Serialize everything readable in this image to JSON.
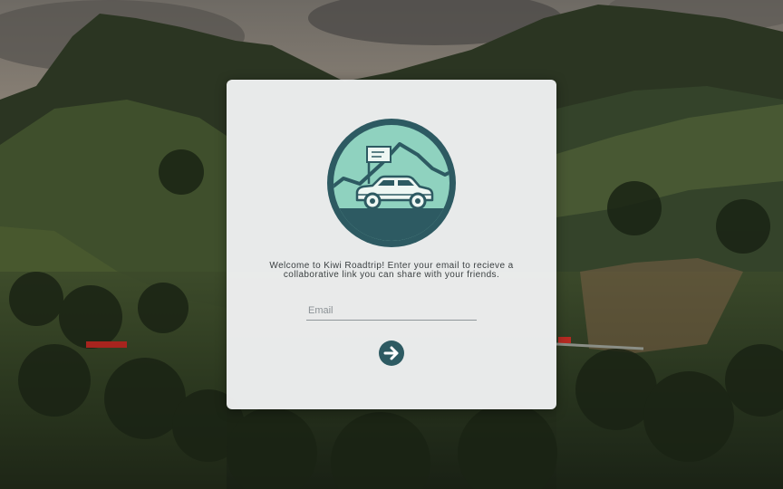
{
  "app": {
    "name": "Kiwi Roadtrip"
  },
  "signup": {
    "welcome_text": "Welcome to Kiwi Roadtrip! Enter your email to recieve a collaborative link you can share with your friends.",
    "email_placeholder": "Email",
    "email_value": "",
    "submit_icon": "arrow-right-icon"
  },
  "logo": {
    "icon": "car-with-flag-icon",
    "colors": {
      "ring": "#2d5a62",
      "fill": "#8fd2bf",
      "road": "#2d5a62"
    }
  },
  "colors": {
    "card": "#f0f1f2",
    "accent": "#2d5a62",
    "text": "#3a3f41"
  }
}
